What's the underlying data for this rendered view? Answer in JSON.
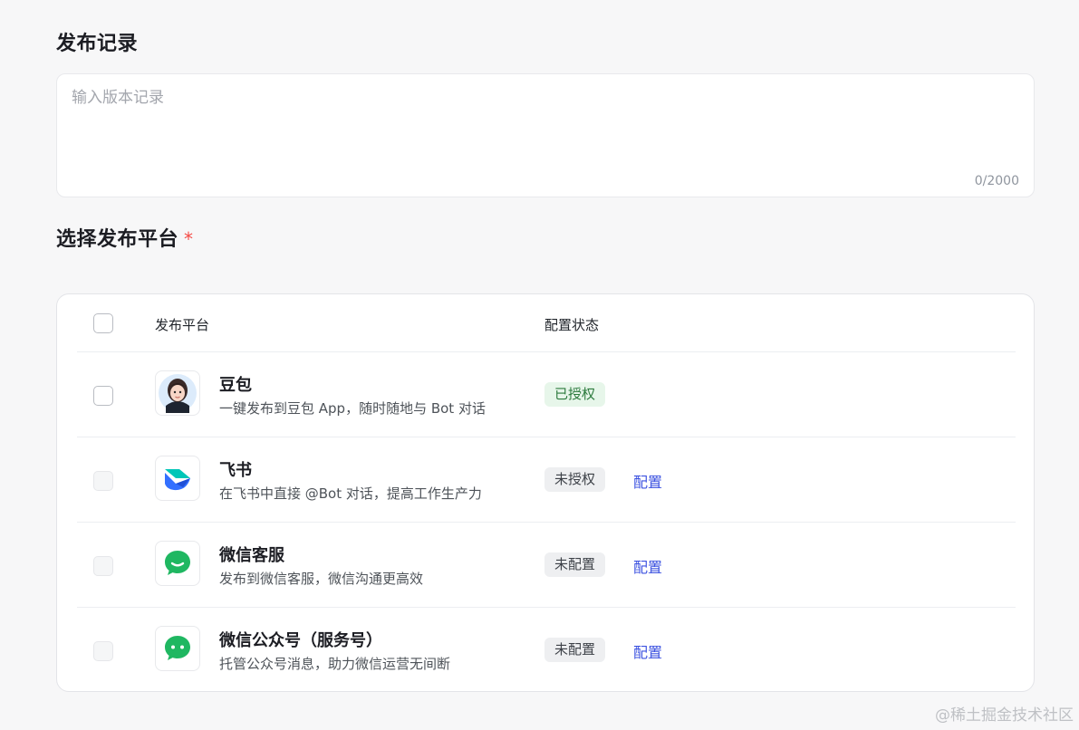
{
  "records": {
    "title": "发布记录",
    "placeholder": "输入版本记录",
    "char_count": "0/2000"
  },
  "platform_section": {
    "title": "选择发布平台",
    "required_mark": "*"
  },
  "table": {
    "headers": {
      "platform": "发布平台",
      "status": "配置状态"
    },
    "rows": [
      {
        "name": "豆包",
        "desc": "一键发布到豆包 App，随时随地与 Bot 对话",
        "status": "已授权",
        "status_type": "ok",
        "action": "",
        "logo": "doubao-avatar-icon"
      },
      {
        "name": "飞书",
        "desc": "在飞书中直接 @Bot 对话，提高工作生产力",
        "status": "未授权",
        "status_type": "no",
        "action": "配置",
        "logo": "feishu-icon"
      },
      {
        "name": "微信客服",
        "desc": "发布到微信客服，微信沟通更高效",
        "status": "未配置",
        "status_type": "no",
        "action": "配置",
        "logo": "wechat-service-icon"
      },
      {
        "name": "微信公众号（服务号）",
        "desc": "托管公众号消息，助力微信运营无间断",
        "status": "未配置",
        "status_type": "no",
        "action": "配置",
        "logo": "wechat-official-icon"
      }
    ]
  },
  "watermark": "@稀土掘金技术社区",
  "colors": {
    "accent_link": "#3c52e0",
    "authorized_bg": "#e7f6ea",
    "authorized_text": "#2c7a3d",
    "required_star": "#f54a45",
    "wechat_green": "#1fb761"
  }
}
